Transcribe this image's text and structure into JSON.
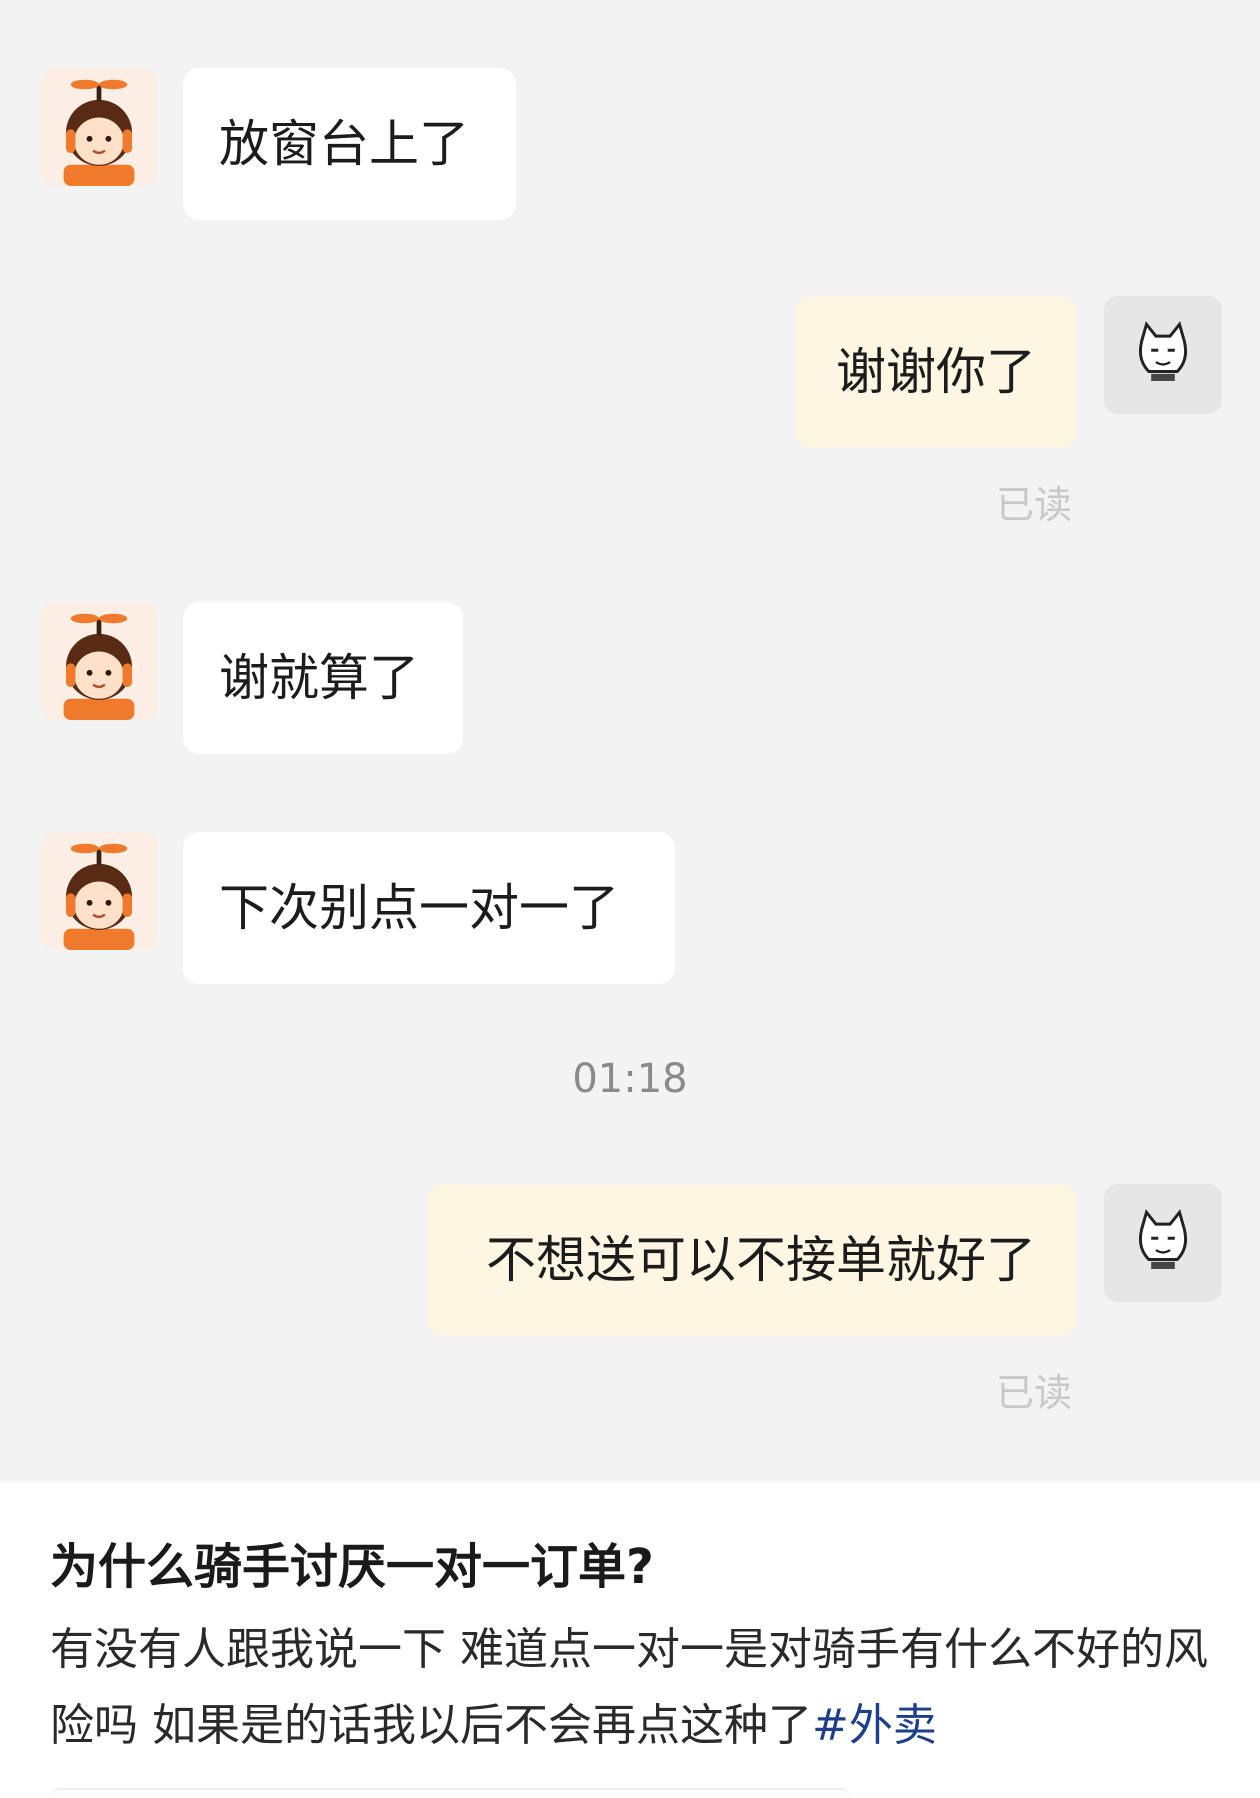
{
  "messages": [
    {
      "side": "in",
      "text": "放窗台上了"
    },
    {
      "side": "out",
      "text": "谢谢你了",
      "status": "已读"
    },
    {
      "side": "in",
      "text": "谢就算了"
    },
    {
      "side": "in",
      "text": "下次别点一对一了"
    },
    {
      "side": "out",
      "text": "不想送可以不接单就好了",
      "status": "已读"
    }
  ],
  "timestamp": "01:18",
  "avatars": {
    "rider": "rider-avatar-icon",
    "user": "cat-sketch-avatar-icon"
  },
  "post": {
    "title": "为什么骑手讨厌一对一订单?",
    "body": "有没有人跟我说一下 难道点一对一是对骑手有什么不好的风险吗 如果是的话我以后不会再点这种了",
    "hashtag": "#外卖"
  },
  "colors": {
    "chat_bg": "#f3f3f3",
    "incoming_bubble": "#ffffff",
    "outgoing_bubble": "#fdf6e3",
    "hashtag": "#1d3f8a",
    "rider_orange": "#f07a2c"
  }
}
